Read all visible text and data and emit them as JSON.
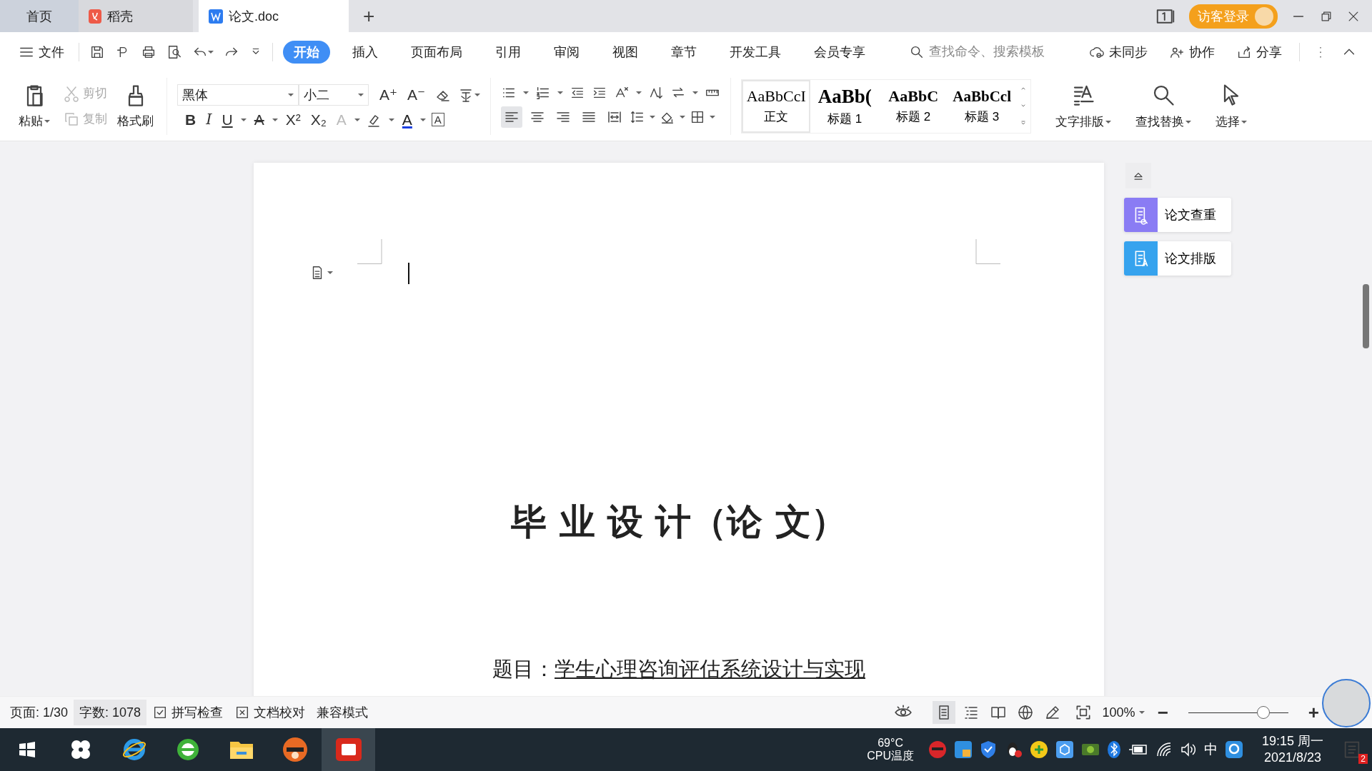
{
  "tabs": [
    {
      "label": "首页",
      "kind": "home",
      "selected": false
    },
    {
      "label": "稻壳",
      "kind": "docer",
      "selected": false
    },
    {
      "label": "论文.doc",
      "kind": "doc",
      "selected": true
    }
  ],
  "new_tab": "+",
  "login": "访客登录",
  "menu": {
    "file": "文件",
    "tabs": [
      {
        "label": "开始",
        "selected": true
      },
      {
        "label": "插入",
        "selected": false
      },
      {
        "label": "页面布局",
        "selected": false
      },
      {
        "label": "引用",
        "selected": false
      },
      {
        "label": "审阅",
        "selected": false
      },
      {
        "label": "视图",
        "selected": false
      },
      {
        "label": "章节",
        "selected": false
      },
      {
        "label": "开发工具",
        "selected": false
      },
      {
        "label": "会员专享",
        "selected": false
      }
    ],
    "search": {
      "placeholder": "查找命令、搜索模板"
    },
    "actions": [
      {
        "label": "未同步",
        "kind": "sync"
      },
      {
        "label": "协作",
        "kind": "collab"
      },
      {
        "label": "分享",
        "kind": "share"
      }
    ]
  },
  "clipboard": {
    "paste": "粘贴",
    "cut": {
      "label": "剪切",
      "disabled": true
    },
    "copy": {
      "label": "复制",
      "disabled": true
    },
    "painter": "格式刷"
  },
  "font": {
    "name": "黑体",
    "size": "小二",
    "grow": "A⁺",
    "shrink": "A⁻",
    "format": [
      {
        "glyph": "B",
        "kind": "bold"
      },
      {
        "glyph": "I",
        "kind": "italic"
      },
      {
        "glyph": "U",
        "kind": "underline"
      },
      {
        "glyph": "A",
        "kind": "strike"
      },
      {
        "glyph": "X²",
        "kind": "sup"
      },
      {
        "glyph": "X₂",
        "kind": "sub"
      },
      {
        "glyph": "A",
        "kind": "effect"
      },
      {
        "glyph": "A",
        "kind": "color"
      },
      {
        "glyph": "A",
        "kind": "border"
      }
    ]
  },
  "alignment": [
    {
      "kind": "left",
      "selected": true
    },
    {
      "kind": "center",
      "selected": false
    },
    {
      "kind": "right",
      "selected": false
    },
    {
      "kind": "justify",
      "selected": false
    },
    {
      "kind": "distribute",
      "selected": false
    }
  ],
  "styles": [
    {
      "sample": "AaBbCcI",
      "label": "正文",
      "kind": "body",
      "selected": true
    },
    {
      "sample": "AaBb(",
      "label": "标题 1",
      "kind": "h1",
      "selected": false
    },
    {
      "sample": "AaBbC",
      "label": "标题 2",
      "kind": "h2",
      "selected": false
    },
    {
      "sample": "AaBbCcl",
      "label": "标题 3",
      "kind": "h3",
      "selected": false
    }
  ],
  "tools": [
    {
      "label": "文字排版",
      "kind": "layout"
    },
    {
      "label": "查找替换",
      "kind": "find"
    },
    {
      "label": "选择",
      "kind": "select"
    }
  ],
  "document": {
    "title": "毕 业 设 计（论 文）",
    "subject_label": "题目：",
    "subject": "学生心理咨询评估系统设计与实现"
  },
  "side_panel": [
    {
      "label": "论文查重",
      "color": "#8a7cf4"
    },
    {
      "label": "论文排版",
      "color": "#36a3ee"
    }
  ],
  "status_bar": {
    "page": "页面: 1/30",
    "words": "字数: 1078",
    "spell": "拼写检查",
    "proof": "文档校对",
    "mode": "兼容模式",
    "views": [
      {
        "kind": "page",
        "selected": true
      },
      {
        "kind": "outline",
        "selected": false
      },
      {
        "kind": "read",
        "selected": false
      },
      {
        "kind": "web",
        "selected": false
      },
      {
        "kind": "write",
        "selected": false
      }
    ],
    "zoom": "100%",
    "zoom_minus": "−",
    "zoom_plus": "+",
    "zoom_slider": {
      "level": 0.75
    }
  },
  "taskbar": {
    "cpu_temp": "69°C",
    "cpu_label": "CPU温度",
    "ime": "中",
    "time": "19:15 周一",
    "date": "2021/8/23",
    "notifications": "2"
  }
}
